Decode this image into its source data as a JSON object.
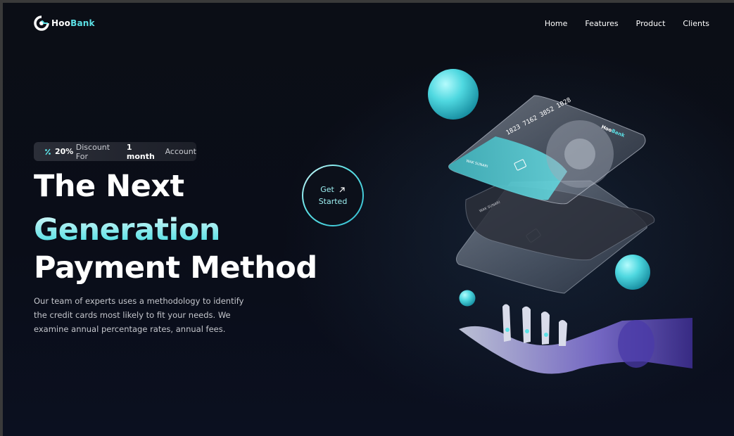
{
  "brand": {
    "name_part1": "Hoo",
    "name_part2": "Bank"
  },
  "nav": {
    "items": [
      {
        "label": "Home"
      },
      {
        "label": "Features"
      },
      {
        "label": "Product"
      },
      {
        "label": "Clients"
      }
    ]
  },
  "discount": {
    "value": "20%",
    "text_before": "Discount For",
    "highlight": "1 month",
    "text_after": "Account"
  },
  "hero": {
    "line1": "The Next",
    "line2": "Generation",
    "line3": "Payment Method",
    "paragraph": "Our team of experts uses a methodology to identify the credit cards most likely to fit your needs. We examine annual percentage rates, annual fees."
  },
  "cta": {
    "line1": "Get",
    "line2": "Started"
  },
  "cards": {
    "number": "1823 7162 3852 1028",
    "holder": "WAK SUNARI",
    "card_brand_part1": "Hoo",
    "card_brand_part2": "Bank"
  },
  "colors": {
    "accent": "#5ce1e6",
    "background": "#00040f"
  }
}
